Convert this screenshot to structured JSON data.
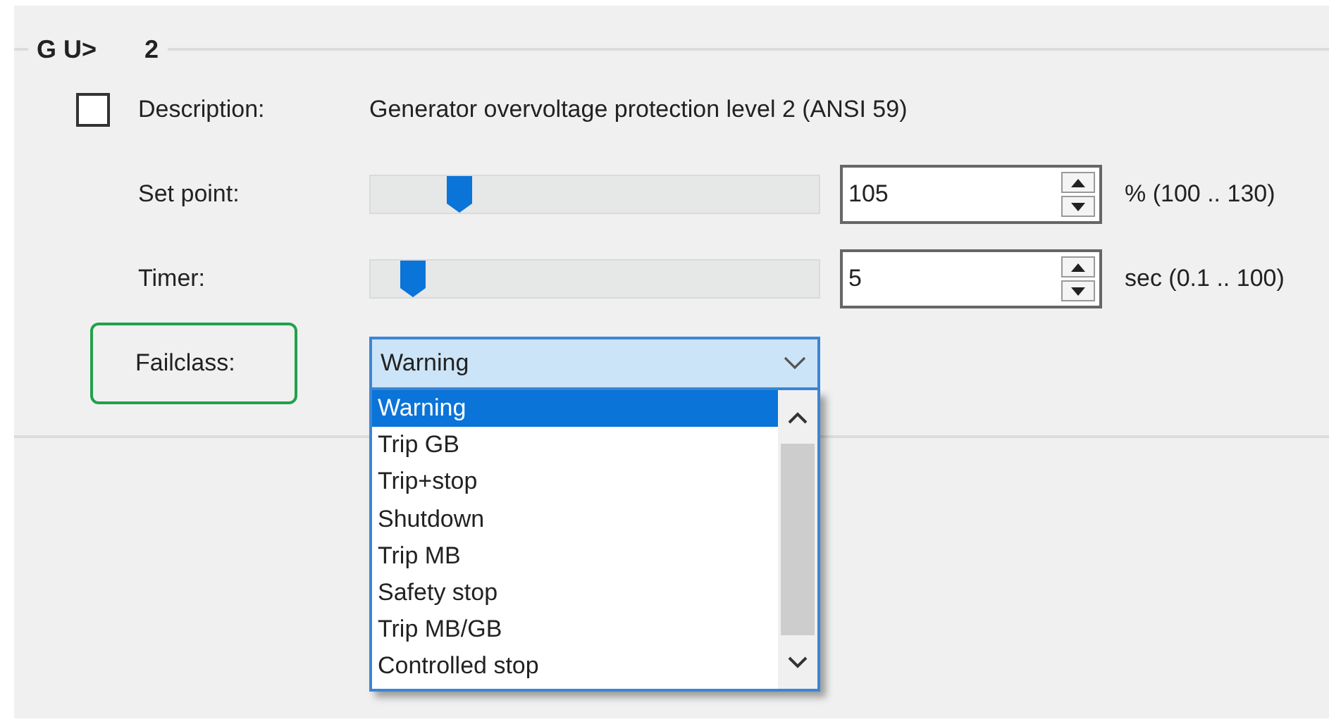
{
  "group": {
    "title": "G U>",
    "number": "2"
  },
  "enabled": {
    "checked": false
  },
  "description": {
    "label": "Description:",
    "value": "Generator overvoltage protection level 2 (ANSI 59)"
  },
  "settings": [
    {
      "label": "Set point:",
      "level": 0.18,
      "value": "105",
      "unit": "% (100 .. 130)"
    },
    {
      "label": "Timer:",
      "level": 0.07,
      "value": "5",
      "unit": "sec (0.1 .. 100)"
    }
  ],
  "failclass": {
    "label": "Failclass:",
    "highlighted": true,
    "value": "Warning",
    "expanded": true,
    "options": [
      {
        "label": "Warning",
        "selected": true
      },
      {
        "label": "Trip GB",
        "selected": false
      },
      {
        "label": "Trip+stop",
        "selected": false
      },
      {
        "label": "Shutdown",
        "selected": false
      },
      {
        "label": "Trip MB",
        "selected": false
      },
      {
        "label": "Safety stop",
        "selected": false
      },
      {
        "label": "Trip MB/GB",
        "selected": false
      },
      {
        "label": "Controlled stop",
        "selected": false
      }
    ]
  }
}
